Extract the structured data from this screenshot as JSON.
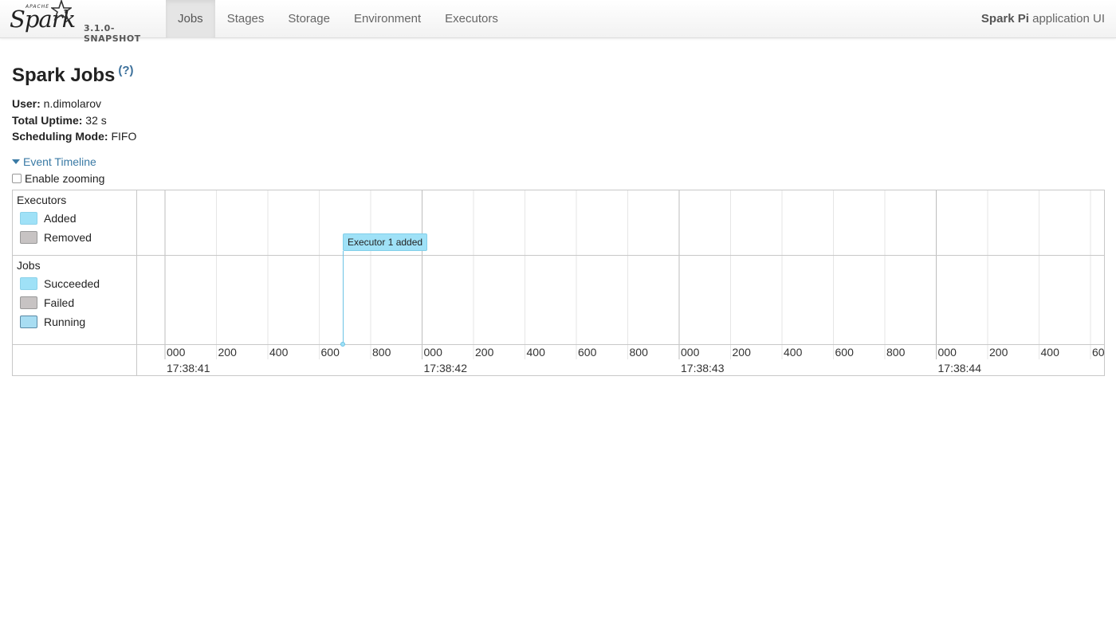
{
  "brand": {
    "apache": "APACHE",
    "name": "Spark",
    "version": "3.1.0-SNAPSHOT"
  },
  "nav": {
    "tabs": [
      {
        "label": "Jobs",
        "active": true
      },
      {
        "label": "Stages",
        "active": false
      },
      {
        "label": "Storage",
        "active": false
      },
      {
        "label": "Environment",
        "active": false
      },
      {
        "label": "Executors",
        "active": false
      }
    ],
    "app_name": "Spark Pi",
    "app_suffix": " application UI"
  },
  "page": {
    "title": "Spark Jobs",
    "help": "(?)",
    "user_label": "User:",
    "user": " n.dimolarov",
    "uptime_label": "Total Uptime:",
    "uptime": " 32 s",
    "mode_label": "Scheduling Mode:",
    "mode": " FIFO"
  },
  "timeline": {
    "toggle_label": "Event Timeline",
    "zoom_label": "Enable zooming",
    "zoom_enabled": false,
    "groups": {
      "executors": {
        "title": "Executors",
        "legend": [
          "Added",
          "Removed"
        ]
      },
      "jobs": {
        "title": "Jobs",
        "legend": [
          "Succeeded",
          "Failed",
          "Running"
        ]
      }
    },
    "colors": {
      "added": "#9fe1f7",
      "removed": "#c7c3c3",
      "running": "#a8ddf2"
    },
    "axis": {
      "minor_ticks": [
        "000",
        "200",
        "400",
        "600",
        "800"
      ],
      "major_ticks": [
        "17:38:41",
        "17:38:42",
        "17:38:43",
        "17:38:44"
      ]
    },
    "event": {
      "label": "Executor 1 added",
      "time": "17:38:41.690"
    }
  }
}
